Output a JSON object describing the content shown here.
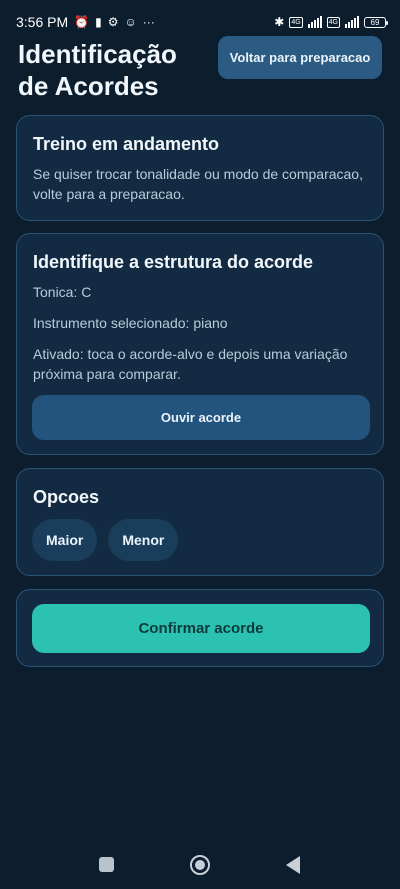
{
  "status_bar": {
    "time": "3:56 PM",
    "battery": "69",
    "net1": "4G",
    "net2": "4G"
  },
  "header": {
    "title": "Identificação de Acordes",
    "back_button": "Voltar para preparacao"
  },
  "progress_card": {
    "title": "Treino em andamento",
    "text": "Se quiser trocar tonalidade ou modo de comparacao, volte para a preparacao."
  },
  "question_card": {
    "title": "Identifique a estrutura do acorde",
    "tonic": "Tonica: C",
    "instrument": "Instrumento selecionado: piano",
    "activated": "Ativado: toca o acorde-alvo e depois uma variação próxima para comparar.",
    "listen_button": "Ouvir acorde"
  },
  "options_card": {
    "title": "Opcoes",
    "options": [
      "Maior",
      "Menor"
    ]
  },
  "confirm_card": {
    "confirm_button": "Confirmar acorde"
  },
  "colors": {
    "background": "#0c1d2e",
    "card": "#132b42",
    "accent": "#2cc2b1",
    "button": "#2b5a82"
  }
}
